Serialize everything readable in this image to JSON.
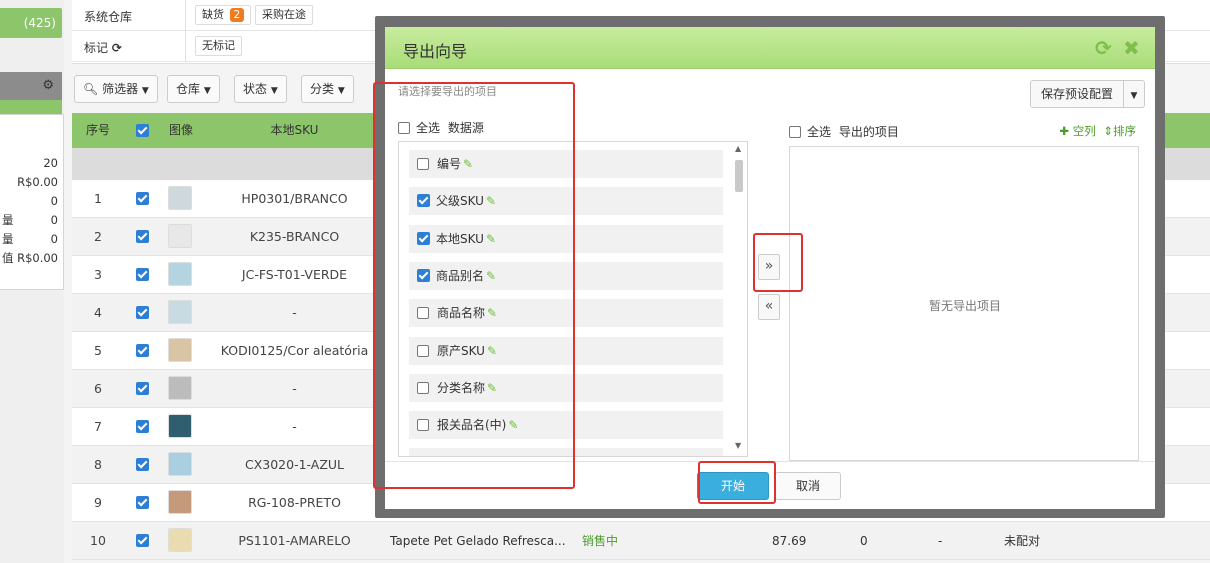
{
  "sidebar": {
    "count_badge": "(425)",
    "stats": [
      {
        "k": "",
        "v": "20"
      },
      {
        "k": "",
        "v": "R$0.00"
      },
      {
        "k": "",
        "v": "0"
      },
      {
        "k": "量",
        "v": "0"
      },
      {
        "k": "量",
        "v": "0"
      },
      {
        "k": "值",
        "v": "R$0.00"
      }
    ]
  },
  "filters": {
    "warehouse_label": "系统仓库",
    "shortage_label": "缺货",
    "shortage_count": "2",
    "purchasing_label": "采购在途",
    "tag_label": "标记",
    "untagged_label": "无标记"
  },
  "toolbar": {
    "filter": "筛选器",
    "warehouse": "仓库",
    "status": "状态",
    "category": "分类"
  },
  "table": {
    "headers": [
      "序号",
      "图像",
      "本地SKU"
    ],
    "rows": [
      {
        "no": "1",
        "sku": "HP0301/BRANCO"
      },
      {
        "no": "2",
        "sku": "K235-BRANCO"
      },
      {
        "no": "3",
        "sku": "JC-FS-T01-VERDE"
      },
      {
        "no": "4",
        "sku": "-"
      },
      {
        "no": "5",
        "sku": "KODI0125/Cor aleatória"
      },
      {
        "no": "6",
        "sku": "-"
      },
      {
        "no": "7",
        "sku": "-"
      },
      {
        "no": "8",
        "sku": "CX3020-1-AZUL"
      },
      {
        "no": "9",
        "sku": "RG-108-PRETO"
      },
      {
        "no": "10",
        "sku": "PS1101-AMARELO"
      }
    ],
    "last_row": {
      "name": "Tapete Pet Gelado Refresca...",
      "status": "销售中",
      "price": "87.69",
      "qty": "0",
      "dash": "-",
      "match": "未配对"
    }
  },
  "modal": {
    "title": "导出向导",
    "hint": "请选择要导出的项目",
    "select_all": "全选",
    "source_title": "数据源",
    "target_title": "导出的项目",
    "add_blank": "空列",
    "sort": "排序",
    "preset_button": "保存预设配置",
    "empty_text": "暂无导出项目",
    "move_right": "»",
    "move_left": "«",
    "start": "开始",
    "cancel": "取消",
    "fields": [
      {
        "label": "编号",
        "checked": false
      },
      {
        "label": "父级SKU",
        "checked": true
      },
      {
        "label": "本地SKU",
        "checked": true
      },
      {
        "label": "商品别名",
        "checked": true
      },
      {
        "label": "商品名称",
        "checked": false
      },
      {
        "label": "原产SKU",
        "checked": false
      },
      {
        "label": "分类名称",
        "checked": false
      },
      {
        "label": "报关品名(中)",
        "checked": false
      }
    ]
  },
  "colors": {
    "header_green": "#8cc56a",
    "start_blue": "#3aaedc",
    "highlight_red": "#e03131",
    "checkbox_blue": "#2d7fd6"
  }
}
